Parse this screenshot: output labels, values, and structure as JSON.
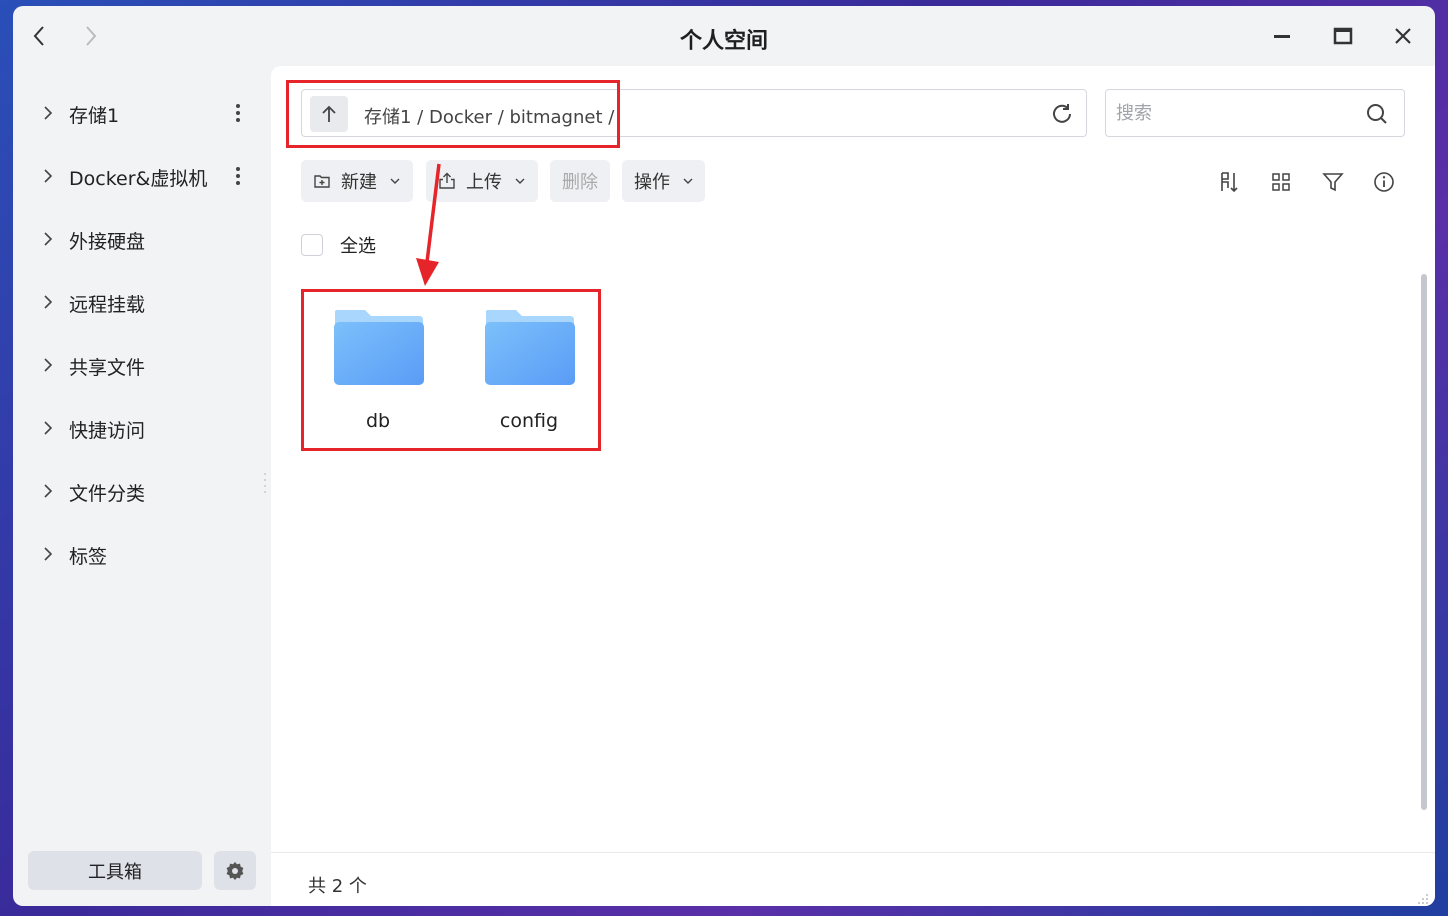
{
  "window": {
    "title": "个人空间",
    "controls": [
      "minimize-icon",
      "maximize-icon",
      "close-icon"
    ]
  },
  "nav": {
    "back_icon": "chevron-left-icon",
    "forward_icon": "chevron-right-icon"
  },
  "sidebar": {
    "items": [
      {
        "label": "存储1",
        "has_more": true
      },
      {
        "label": "Docker&虚拟机",
        "has_more": true
      },
      {
        "label": "外接硬盘",
        "has_more": false
      },
      {
        "label": "远程挂载",
        "has_more": false
      },
      {
        "label": "共享文件",
        "has_more": false
      },
      {
        "label": "快捷访问",
        "has_more": false
      },
      {
        "label": "文件分类",
        "has_more": false
      },
      {
        "label": "标签",
        "has_more": false
      }
    ],
    "toolbox_label": "工具箱",
    "settings_icon": "gear-icon"
  },
  "pathbar": {
    "path": "存储1 / Docker / bitmagnet /"
  },
  "search": {
    "placeholder": "搜索",
    "value": ""
  },
  "toolbar": {
    "new_label": "新建",
    "upload_label": "上传",
    "delete_label": "删除",
    "ops_label": "操作"
  },
  "view_icons": [
    "sort-icon",
    "grid-view-icon",
    "filter-icon",
    "info-icon"
  ],
  "selectall_label": "全选",
  "files": [
    {
      "name": "db",
      "type": "folder"
    },
    {
      "name": "config",
      "type": "folder"
    }
  ],
  "status": {
    "count_text": "共 2 个"
  },
  "colors": {
    "highlight": "#e5252a",
    "folder": "#6aaef7"
  }
}
